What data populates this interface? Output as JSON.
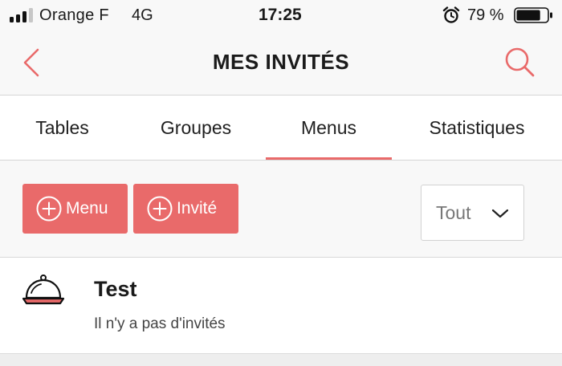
{
  "status_bar": {
    "carrier": "Orange F",
    "network": "4G",
    "time": "17:25",
    "battery": "79 %",
    "battery_level": 0.79,
    "signal_bars_active": 3,
    "signal_bars_total": 4,
    "icons": [
      "signal-icon",
      "alarm-clock-icon",
      "battery-icon"
    ]
  },
  "header": {
    "title": "MES INVITÉS",
    "back_icon": "chevron-left-icon",
    "search_icon": "search-icon"
  },
  "tabs": [
    {
      "label": "Tables",
      "active": false
    },
    {
      "label": "Groupes",
      "active": false
    },
    {
      "label": "Menus",
      "active": true
    },
    {
      "label": "Statistiques",
      "active": false
    }
  ],
  "actions": {
    "add_menu_label": "Menu",
    "add_guest_label": "Invité",
    "plus_icon": "plus-circle-icon",
    "filter": {
      "selected": "Tout",
      "icon": "chevron-down-icon"
    }
  },
  "menus": [
    {
      "name": "Test",
      "subtitle": "Il n'y a pas d'invités",
      "icon": "cloche-icon"
    }
  ],
  "colors": {
    "accent": "#e96a6a",
    "bar_background": "#f8f8f8",
    "text": "#1a1a1a"
  }
}
